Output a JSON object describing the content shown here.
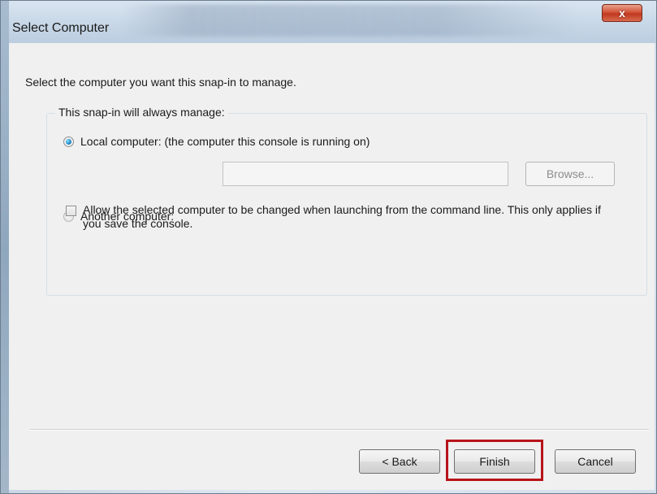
{
  "window": {
    "title": "Select Computer",
    "close_glyph": "x"
  },
  "dialog": {
    "intro": "Select the computer you want this snap-in to manage.",
    "group_label": "This snap-in will always manage:",
    "local_option": {
      "label": "Local computer:  (the computer this console is running on)",
      "selected": true
    },
    "another_option": {
      "label": "Another computer:",
      "selected": false
    },
    "another_computer_value": "",
    "browse_label": "Browse...",
    "allow_change": {
      "label": "Allow the selected computer to be changed when launching from the command line.  This only applies if you save the console.",
      "checked": false
    }
  },
  "footer": {
    "back_label": "< Back",
    "finish_label": "Finish",
    "cancel_label": "Cancel"
  },
  "colors": {
    "highlight": "#b7141a",
    "close_button": "#c9462c",
    "radio_selected": "#1c83c6"
  },
  "icons": {
    "close": "close-icon"
  }
}
